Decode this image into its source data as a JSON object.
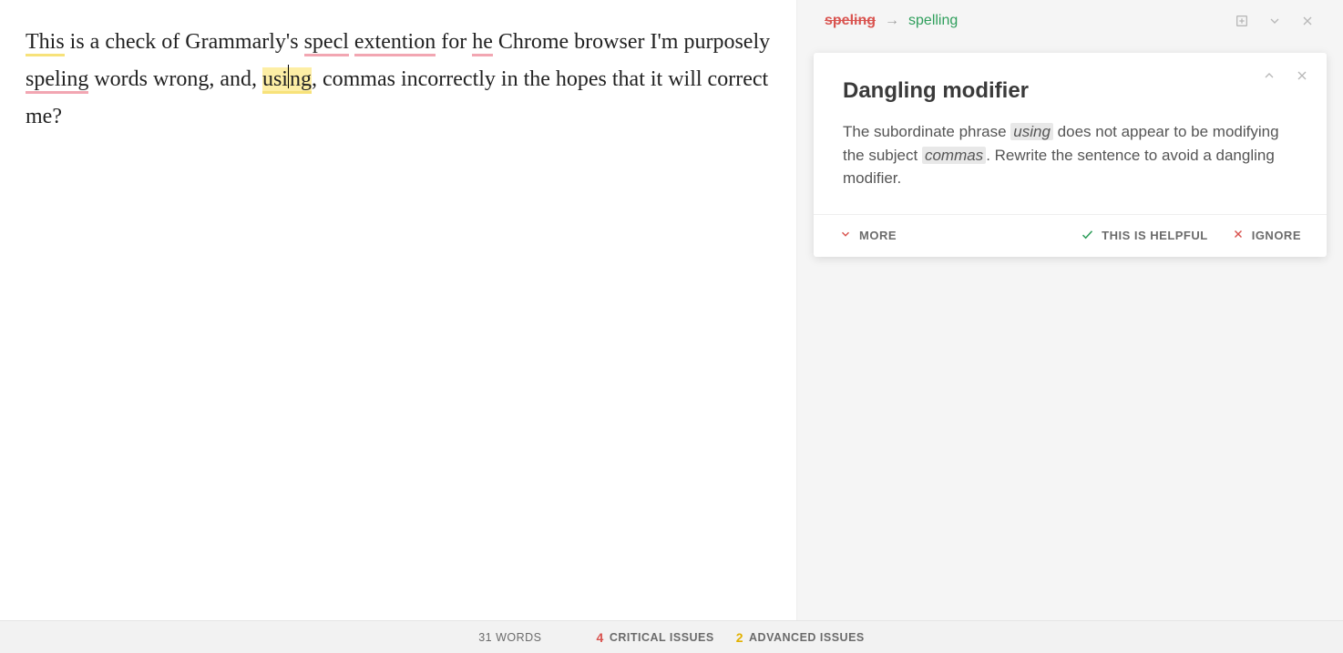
{
  "editor": {
    "seg1": "This",
    "seg2": " is a check of Grammarly's ",
    "seg3": "specl",
    "seg4": " ",
    "seg5": "extention",
    "seg6": " for ",
    "seg7": "he",
    "seg8": " Chrome browser I'm purposely ",
    "seg9": "speling",
    "seg10": " words wrong, and, ",
    "seg11a": "usi",
    "seg11b": "ng",
    "seg12": ", commas incorrectly in the hopes that it will correct me?"
  },
  "mini": {
    "strike": "speling",
    "arrow": "→",
    "replace": "spelling"
  },
  "card": {
    "title": "Dangling modifier",
    "pre": "The subordinate phrase ",
    "chip1": "using",
    "mid": " does not appear to be modifying the subject ",
    "chip2": "commas",
    "post": ". Rewrite the sentence to avoid a dangling modifier.",
    "more": "MORE",
    "helpful": "THIS IS HELPFUL",
    "ignore": "IGNORE"
  },
  "status": {
    "words": "31 WORDS",
    "criticalCount": "4",
    "criticalLabel": "CRITICAL ISSUES",
    "advancedCount": "2",
    "advancedLabel": "ADVANCED ISSUES"
  }
}
